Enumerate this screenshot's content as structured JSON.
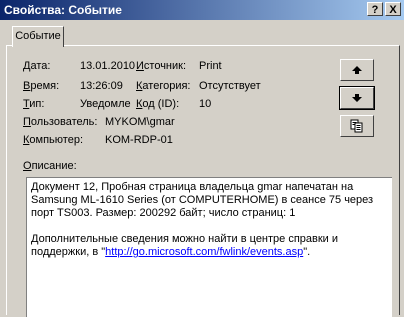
{
  "window": {
    "title": "Свойства: Событие",
    "help_label": "?",
    "close_label": "X"
  },
  "tab": {
    "label": "Событие"
  },
  "fields": {
    "date": {
      "label": "Дата:",
      "value": "13.01.2010"
    },
    "time": {
      "label": "Время:",
      "value": "13:26:09"
    },
    "type": {
      "label": "Тип:",
      "value": "Уведомле"
    },
    "user": {
      "label": "Пользователь:",
      "value": "MYKOM\\gmar"
    },
    "computer": {
      "label": "Компьютер:",
      "value": "KOM-RDP-01"
    },
    "source": {
      "label": "Источник:",
      "value": "Print"
    },
    "category": {
      "label": "Категория:",
      "value": "Отсутствует"
    },
    "code": {
      "label": "Код (ID):",
      "value": "10"
    }
  },
  "description": {
    "label": "Описание:",
    "paragraph1": "Документ 12, Пробная страница владельца gmar напечатан на Samsung ML-1610 Series (от COMPUTERHOME) в сеансе 75 через порт TS003.  Размер: 200292 байт; число страниц: 1",
    "paragraph2_prefix": "Дополнительные сведения можно найти в центре справки и поддержки, в \"",
    "link": "http://go.microsoft.com/fwlink/events.asp",
    "paragraph2_suffix": "\"."
  },
  "side_buttons": {
    "up_icon": "arrow-up-icon",
    "down_icon": "arrow-down-icon",
    "copy_icon": "copy-icon"
  }
}
